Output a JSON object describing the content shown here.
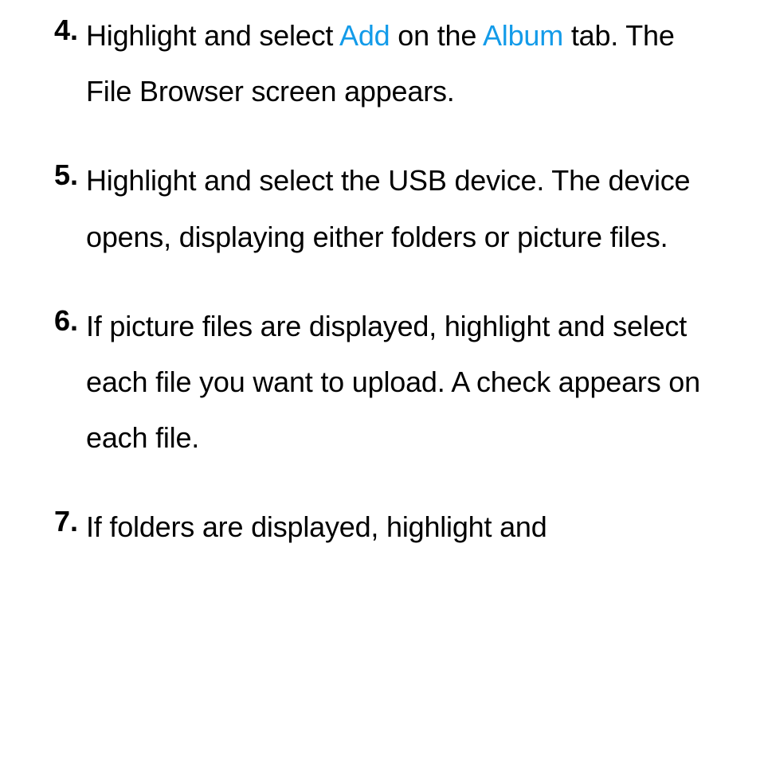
{
  "items": [
    {
      "num": "4.",
      "parts": [
        {
          "t": "Highlight and select "
        },
        {
          "t": "Add",
          "blue": true
        },
        {
          "t": " on the "
        },
        {
          "t": "Album",
          "blue": true
        },
        {
          "t": " tab. The File Browser screen appears."
        }
      ]
    },
    {
      "num": "5.",
      "parts": [
        {
          "t": "Highlight and select the USB device. The device opens, displaying either folders or picture files."
        }
      ]
    },
    {
      "num": "6.",
      "parts": [
        {
          "t": "If picture files are displayed, highlight and select each file you want to upload. A check appears on each file."
        }
      ]
    },
    {
      "num": "7.",
      "parts": [
        {
          "t": "If folders are displayed, highlight and"
        }
      ]
    }
  ]
}
